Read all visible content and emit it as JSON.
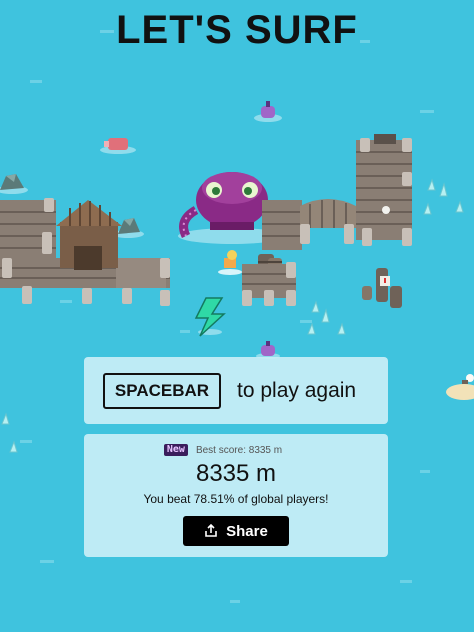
{
  "title": "LET'S SURF",
  "play_again": {
    "key_label": "SPACEBAR",
    "text": "to play again"
  },
  "score": {
    "badge": "New",
    "best_label": "Best score: 8335 m",
    "value": "8335 m",
    "beat_text": "You beat 78.51% of global players!",
    "share_label": "Share"
  },
  "icons": {
    "share": "share-upload-icon",
    "energy": "lightning-bolt-icon"
  },
  "colors": {
    "water": "#3fc3de",
    "panel": "#c8eef6",
    "kraken": "#8a2a86",
    "share_button": "#000000"
  }
}
